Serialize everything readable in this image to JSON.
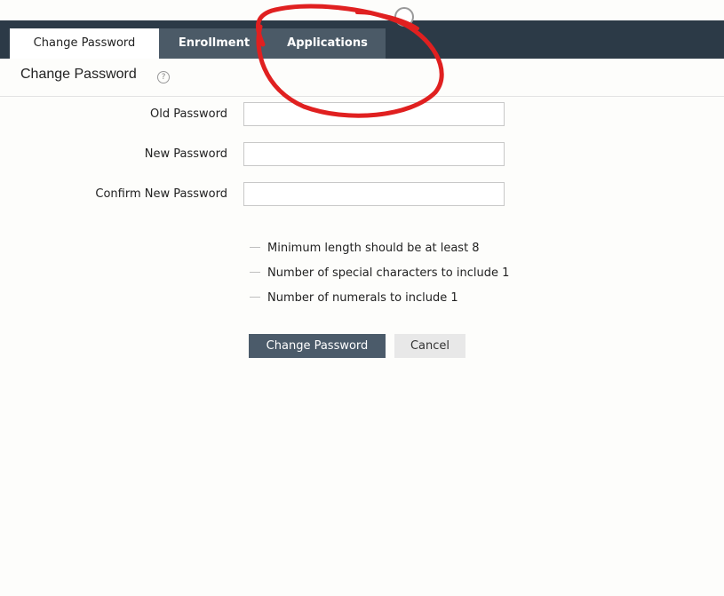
{
  "tabs": [
    {
      "label": "Change Password",
      "active": true
    },
    {
      "label": "Enrollment",
      "active": false
    },
    {
      "label": "Applications",
      "active": false
    }
  ],
  "page": {
    "title": "Change Password",
    "help_glyph": "?"
  },
  "form": {
    "old_password_label": "Old Password",
    "new_password_label": "New Password",
    "confirm_password_label": "Confirm New Password",
    "old_password_value": "",
    "new_password_value": "",
    "confirm_password_value": ""
  },
  "rules": [
    "Minimum length should be at least 8",
    "Number of special characters to include 1",
    "Number of numerals to include 1"
  ],
  "buttons": {
    "submit": "Change Password",
    "cancel": "Cancel"
  },
  "colors": {
    "topbar": "#2c3a47",
    "inactive_tab": "#4b5a67",
    "primary_button": "#4b5b6a",
    "annotation_circle": "#e02020"
  },
  "icons": {
    "help": "help-circle-icon"
  }
}
